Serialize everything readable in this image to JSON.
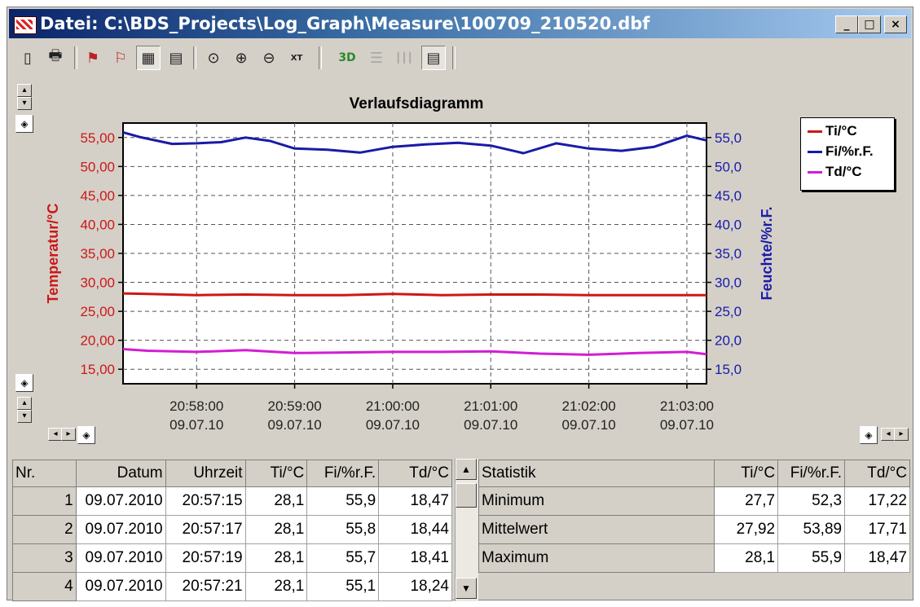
{
  "window": {
    "title": "Datei: C:\\BDS_Projects\\Log_Graph\\Measure\\100709_210520.dbf",
    "buttons": {
      "minimize": "_",
      "maximize": "□",
      "close": "×"
    }
  },
  "toolbar": {
    "items": [
      {
        "name": "new-icon",
        "glyph": "▯"
      },
      {
        "name": "print-icon",
        "glyph": "🖶"
      },
      {
        "name": "graph-flag-icon",
        "glyph": "⚑"
      },
      {
        "name": "graph-cursor-icon",
        "glyph": "⚐"
      },
      {
        "name": "graph-grid-icon",
        "glyph": "▦"
      },
      {
        "name": "table-icon",
        "glyph": "▤"
      },
      {
        "name": "zoom-fit-icon",
        "glyph": "⊙"
      },
      {
        "name": "zoom-in-icon",
        "glyph": "⊕"
      },
      {
        "name": "zoom-out-icon",
        "glyph": "⊖"
      },
      {
        "name": "zoom-xt-icon",
        "glyph": "XT"
      },
      {
        "name": "3d-icon",
        "glyph": "3D"
      },
      {
        "name": "horizontal-lines-icon",
        "glyph": "☰"
      },
      {
        "name": "vertical-lines-icon",
        "glyph": "┃┃┃"
      },
      {
        "name": "legend-icon",
        "glyph": "▤"
      }
    ]
  },
  "chart_data": {
    "type": "line",
    "title": "Verlaufsdiagramm",
    "ylabel_left": "Temperatur/°C",
    "ylabel_right": "Feuchte/%r.F.",
    "y_left_ticks": [
      "55,00",
      "50,00",
      "45,00",
      "40,00",
      "35,00",
      "30,00",
      "25,00",
      "20,00",
      "15,00"
    ],
    "y_right_ticks": [
      "55,0",
      "50,0",
      "45,0",
      "40,0",
      "35,0",
      "30,0",
      "25,0",
      "20,0",
      "15,0"
    ],
    "ylim_left": [
      12.5,
      57.5
    ],
    "ylim_right": [
      12.5,
      57.5
    ],
    "x_ticks": [
      {
        "time": "20:58:00",
        "date": "09.07.10"
      },
      {
        "time": "20:59:00",
        "date": "09.07.10"
      },
      {
        "time": "21:00:00",
        "date": "09.07.10"
      },
      {
        "time": "21:01:00",
        "date": "09.07.10"
      },
      {
        "time": "21:02:00",
        "date": "09.07.10"
      },
      {
        "time": "21:03:00",
        "date": "09.07.10"
      }
    ],
    "xlim": [
      "20:57:15",
      "21:03:12"
    ],
    "grid": true,
    "legend_position": "top-right",
    "series": [
      {
        "name": "Ti/°C",
        "color": "#cc1818",
        "axis": "left",
        "t": [
          "20:57:15",
          "20:57:30",
          "20:58:00",
          "20:58:30",
          "20:59:00",
          "20:59:30",
          "21:00:00",
          "21:00:30",
          "21:01:00",
          "21:01:30",
          "21:02:00",
          "21:02:30",
          "21:03:00",
          "21:03:12"
        ],
        "values": [
          28.1,
          28.0,
          27.8,
          27.9,
          27.8,
          27.8,
          28.0,
          27.8,
          27.9,
          27.9,
          27.8,
          27.8,
          27.8,
          27.8
        ]
      },
      {
        "name": "Fi/%r.F.",
        "color": "#1a1aa8",
        "axis": "right",
        "t": [
          "20:57:15",
          "20:57:25",
          "20:57:45",
          "20:58:00",
          "20:58:15",
          "20:58:30",
          "20:58:45",
          "20:59:00",
          "20:59:20",
          "20:59:40",
          "21:00:00",
          "21:00:20",
          "21:00:40",
          "21:01:00",
          "21:01:20",
          "21:01:40",
          "21:02:00",
          "21:02:20",
          "21:02:40",
          "21:03:00",
          "21:03:12"
        ],
        "values": [
          55.9,
          55.1,
          53.9,
          54.0,
          54.2,
          55.0,
          54.4,
          53.1,
          52.9,
          52.4,
          53.4,
          53.8,
          54.1,
          53.6,
          52.3,
          54.0,
          53.1,
          52.7,
          53.4,
          55.3,
          54.5
        ]
      },
      {
        "name": "Td/°C",
        "color": "#d21ed2",
        "axis": "left",
        "t": [
          "20:57:15",
          "20:57:30",
          "20:58:00",
          "20:58:30",
          "20:59:00",
          "20:59:30",
          "21:00:00",
          "21:00:30",
          "21:01:00",
          "21:01:30",
          "21:02:00",
          "21:02:30",
          "21:03:00",
          "21:03:12"
        ],
        "values": [
          18.47,
          18.2,
          18.0,
          18.3,
          17.8,
          17.9,
          18.0,
          18.0,
          18.1,
          17.7,
          17.5,
          17.8,
          18.0,
          17.6
        ]
      }
    ]
  },
  "data_table": {
    "headers": [
      "Nr.",
      "Datum",
      "Uhrzeit",
      "Ti/°C",
      "Fi/%r.F.",
      "Td/°C"
    ],
    "rows": [
      [
        "1",
        "09.07.2010",
        "20:57:15",
        "28,1",
        "55,9",
        "18,47"
      ],
      [
        "2",
        "09.07.2010",
        "20:57:17",
        "28,1",
        "55,8",
        "18,44"
      ],
      [
        "3",
        "09.07.2010",
        "20:57:19",
        "28,1",
        "55,7",
        "18,41"
      ],
      [
        "4",
        "09.07.2010",
        "20:57:21",
        "28,1",
        "55,1",
        "18,24"
      ]
    ]
  },
  "stats_table": {
    "headers": [
      "Statistik",
      "Ti/°C",
      "Fi/%r.F.",
      "Td/°C"
    ],
    "rows": [
      [
        "Minimum",
        "27,7",
        "52,3",
        "17,22"
      ],
      [
        "Mittelwert",
        "27,92",
        "53,89",
        "17,71"
      ],
      [
        "Maximum",
        "28,1",
        "55,9",
        "18,47"
      ]
    ]
  },
  "colors": {
    "temperature_axis": "#cc1818",
    "humidity_axis": "#1a1aa8",
    "window_face": "#d4d0c8"
  }
}
